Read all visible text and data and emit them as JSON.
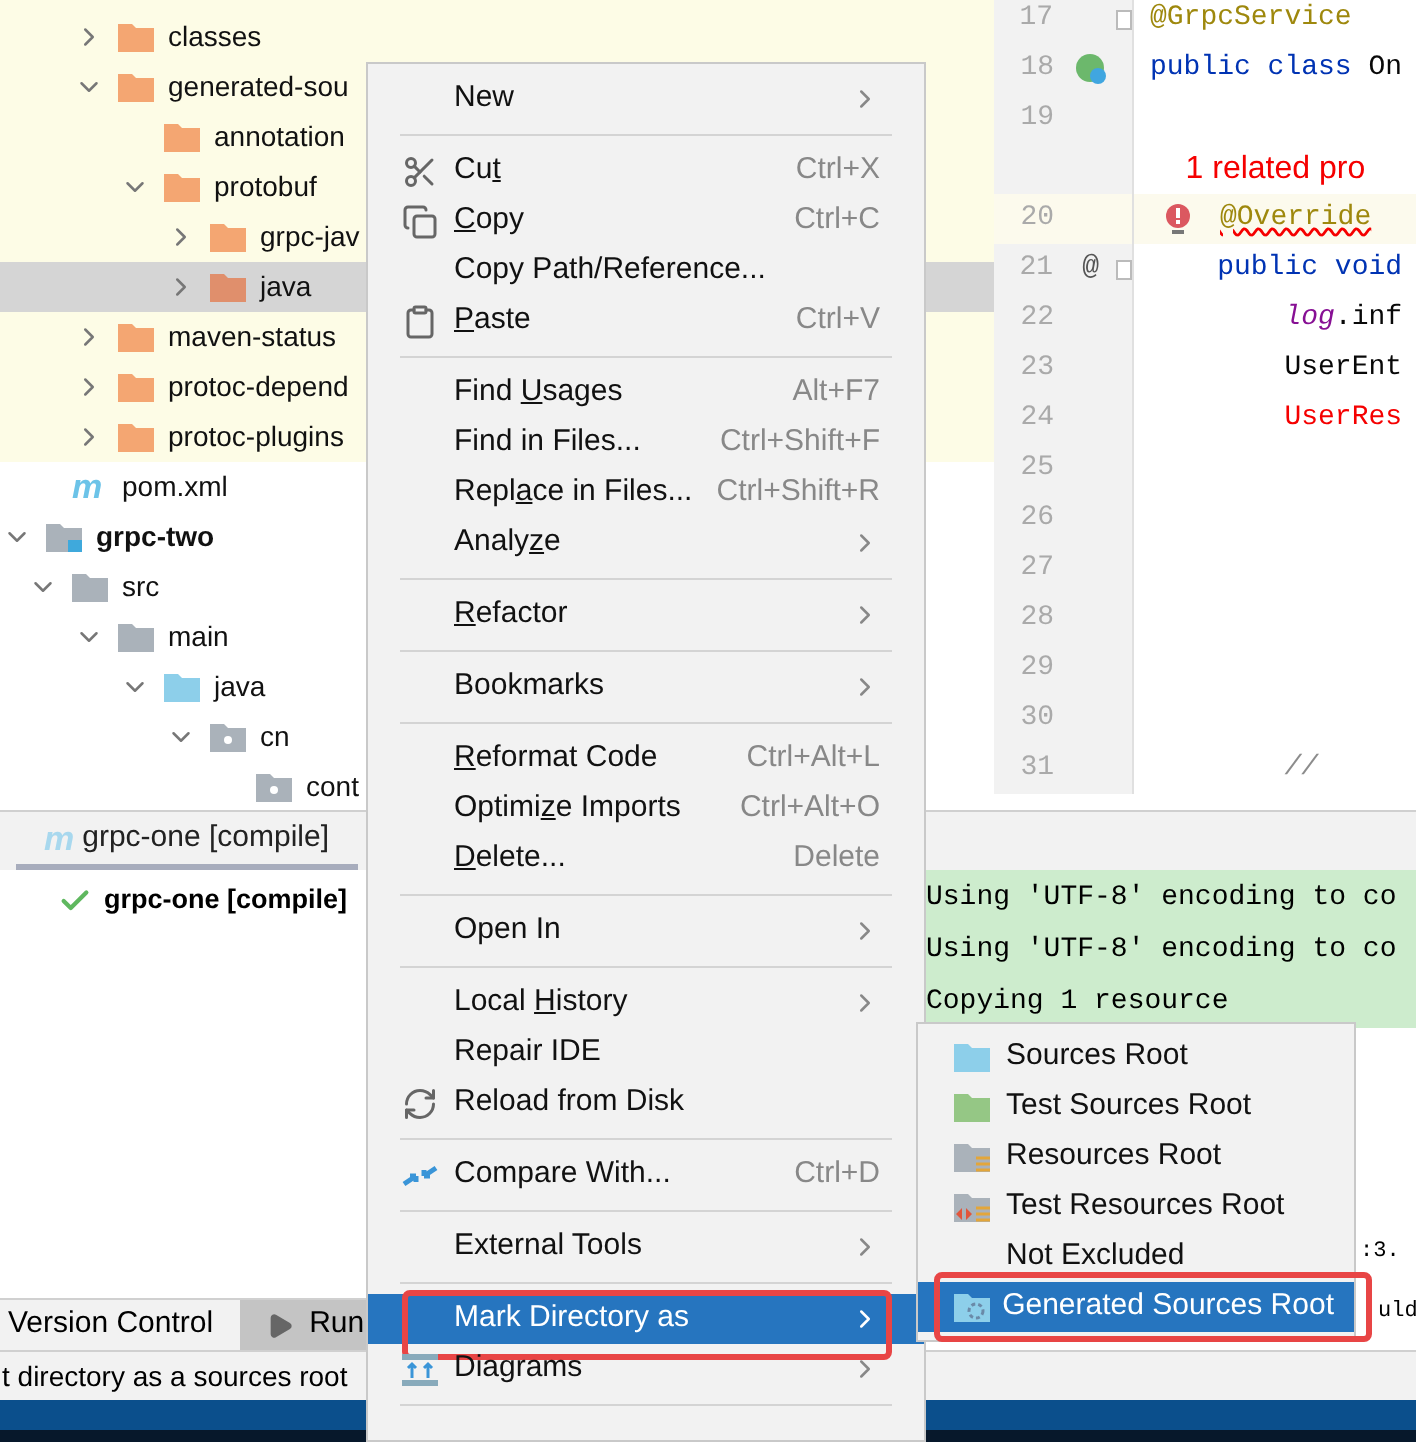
{
  "project_tree": [
    {
      "children": [
        {
          "children": [
            {
              "label": "classes",
              "kind": "excluded-folder",
              "expanded": false,
              "selected": false,
              "excluded": true
            },
            {
              "label": "generated-sou",
              "kind": "excluded-folder",
              "expanded": true,
              "selected": false,
              "excluded": true,
              "children": [
                {
                  "label": "annotation",
                  "kind": "excluded-folder",
                  "selected": false,
                  "excluded": true
                },
                {
                  "label": "protobuf",
                  "kind": "excluded-folder",
                  "expanded": true,
                  "selected": false,
                  "excluded": true,
                  "children": [
                    {
                      "label": "grpc-jav",
                      "kind": "excluded-folder",
                      "expanded": false,
                      "selected": false,
                      "excluded": true
                    },
                    {
                      "label": "java",
                      "kind": "excluded-folder",
                      "expanded": false,
                      "selected": true,
                      "excluded": true
                    }
                  ]
                }
              ]
            },
            {
              "label": "maven-status",
              "kind": "excluded-folder",
              "expanded": false,
              "selected": false,
              "excluded": true
            },
            {
              "label": "protoc-depend",
              "kind": "excluded-folder",
              "expanded": false,
              "selected": false,
              "excluded": true
            },
            {
              "label": "protoc-plugins",
              "kind": "excluded-folder",
              "expanded": false,
              "selected": false,
              "excluded": true
            }
          ]
        },
        {
          "label": "pom.xml",
          "kind": "maven",
          "icon_text": "m",
          "selected": false,
          "excluded": false
        }
      ]
    },
    {
      "label": "grpc-two",
      "kind": "module",
      "expanded": true,
      "selected": false,
      "excluded": false,
      "children": [
        {
          "label": "src",
          "kind": "folder",
          "expanded": true,
          "selected": false,
          "excluded": false,
          "children": [
            {
              "label": "main",
              "kind": "folder",
              "expanded": true,
              "selected": false,
              "excluded": false,
              "children": [
                {
                  "label": "java",
                  "kind": "source-folder",
                  "expanded": true,
                  "selected": false,
                  "excluded": false,
                  "children": [
                    {
                      "label": "cn",
                      "kind": "package",
                      "expanded": true,
                      "selected": false,
                      "excluded": false,
                      "children": [
                        {
                          "label": "cont",
                          "kind": "package",
                          "selected": false,
                          "excluded": false
                        }
                      ]
                    }
                  ]
                }
              ]
            }
          ]
        }
      ]
    }
  ],
  "editor": {
    "lines": [
      {
        "number": "17",
        "kind": "code",
        "fold": true,
        "current": false,
        "tokens": [
          {
            "text": "@GrpcService",
            "kind": "annotation"
          }
        ]
      },
      {
        "number": "18",
        "kind": "bean",
        "current": false,
        "tokens": [
          {
            "text": "public class ",
            "kind": "keyword"
          },
          {
            "text": "On",
            "kind": "plain"
          }
        ]
      },
      {
        "number": "19",
        "kind": "code",
        "current": false
      },
      {
        "kind": "hint",
        "current": false,
        "tokens": [
          {
            "text": "    1 related pro",
            "kind": "error"
          }
        ]
      },
      {
        "number": "20",
        "kind": "error",
        "current": true,
        "tokens": [
          {
            "text": "@Override",
            "kind": "annotation-error"
          }
        ]
      },
      {
        "number": "21",
        "kind": "override",
        "gutter_text": "@",
        "fold": true,
        "current": false,
        "tokens": [
          {
            "text": "    public void",
            "kind": "keyword"
          }
        ]
      },
      {
        "number": "22",
        "kind": "code",
        "current": false,
        "tokens": [
          {
            "text": "        log",
            "kind": "field"
          },
          {
            "text": ".inf",
            "kind": "plain"
          }
        ]
      },
      {
        "number": "23",
        "kind": "code",
        "current": false,
        "tokens": [
          {
            "text": "        UserEnt",
            "kind": "plain"
          }
        ]
      },
      {
        "number": "24",
        "kind": "code",
        "current": false,
        "tokens": [
          {
            "text": "        UserRes",
            "kind": "error"
          }
        ]
      },
      {
        "number": "25",
        "kind": "code",
        "current": false
      },
      {
        "number": "26",
        "kind": "code",
        "current": false
      },
      {
        "number": "27",
        "kind": "code",
        "current": false
      },
      {
        "number": "28",
        "kind": "code",
        "current": false
      },
      {
        "number": "29",
        "kind": "code",
        "current": false
      },
      {
        "number": "30",
        "kind": "code",
        "current": false
      },
      {
        "number": "31",
        "kind": "code",
        "current": false,
        "tokens": [
          {
            "text": "        //",
            "kind": "comment"
          }
        ]
      }
    ]
  },
  "bottom_panel": {
    "tab": {
      "icon_text": "m",
      "label": "grpc-one [compile]",
      "selected": true
    },
    "build_tree": [
      {
        "label": "grpc-one [compile]",
        "kind": "success"
      }
    ],
    "console": [
      {
        "text": "Using 'UTF-8' encoding to co",
        "kind": "info"
      },
      {
        "text": "Using 'UTF-8' encoding to co",
        "kind": "info"
      },
      {
        "text": "Copying 1 resource",
        "kind": "info"
      },
      {
        "text": ":3.",
        "kind": "fragment"
      },
      {
        "text": "uld",
        "kind": "fragment"
      }
    ]
  },
  "tool_strip": [
    {
      "label": "Version Control",
      "kind": "plain",
      "selected": false
    },
    {
      "label": "Run",
      "kind": "run",
      "selected": true
    }
  ],
  "status_bar": {
    "text": "t directory as a sources root"
  },
  "context_menu": [
    {
      "label": "New",
      "submenu": true,
      "selected": false
    },
    {
      "kind": "separator"
    },
    {
      "parts": [
        {
          "text": "Cu",
          "underlined": false
        },
        {
          "text": "t",
          "underlined": true
        }
      ],
      "shortcut": "Ctrl+X",
      "kind": "cut",
      "selected": false
    },
    {
      "parts": [
        {
          "text": "C",
          "underlined": true
        },
        {
          "text": "opy",
          "underlined": false
        }
      ],
      "shortcut": "Ctrl+C",
      "kind": "copy",
      "selected": false
    },
    {
      "label": "Copy Path/Reference...",
      "selected": false
    },
    {
      "parts": [
        {
          "text": "P",
          "underlined": true
        },
        {
          "text": "aste",
          "underlined": false
        }
      ],
      "shortcut": "Ctrl+V",
      "kind": "paste",
      "selected": false
    },
    {
      "kind": "separator"
    },
    {
      "parts": [
        {
          "text": "Find ",
          "underlined": false
        },
        {
          "text": "U",
          "underlined": true
        },
        {
          "text": "sages",
          "underlined": false
        }
      ],
      "shortcut": "Alt+F7",
      "selected": false
    },
    {
      "label": "Find in Files...",
      "shortcut": "Ctrl+Shift+F",
      "selected": false
    },
    {
      "parts": [
        {
          "text": "Repl",
          "underlined": false
        },
        {
          "text": "a",
          "underlined": true
        },
        {
          "text": "ce in Files...",
          "underlined": false
        }
      ],
      "shortcut": "Ctrl+Shift+R",
      "selected": false
    },
    {
      "parts": [
        {
          "text": "Analy",
          "underlined": false
        },
        {
          "text": "z",
          "underlined": true
        },
        {
          "text": "e",
          "underlined": false
        }
      ],
      "submenu": true,
      "selected": false
    },
    {
      "kind": "separator"
    },
    {
      "parts": [
        {
          "text": "R",
          "underlined": true
        },
        {
          "text": "efactor",
          "underlined": false
        }
      ],
      "submenu": true,
      "selected": false
    },
    {
      "kind": "separator"
    },
    {
      "label": "Bookmarks",
      "submenu": true,
      "selected": false
    },
    {
      "kind": "separator"
    },
    {
      "parts": [
        {
          "text": "R",
          "underlined": true
        },
        {
          "text": "eformat Code",
          "underlined": false
        }
      ],
      "shortcut": "Ctrl+Alt+L",
      "selected": false
    },
    {
      "parts": [
        {
          "text": "Optimi",
          "underlined": false
        },
        {
          "text": "z",
          "underlined": true
        },
        {
          "text": "e Imports",
          "underlined": false
        }
      ],
      "shortcut": "Ctrl+Alt+O",
      "selected": false
    },
    {
      "parts": [
        {
          "text": "D",
          "underlined": true
        },
        {
          "text": "elete...",
          "underlined": false
        }
      ],
      "shortcut": "Delete",
      "selected": false
    },
    {
      "kind": "separator"
    },
    {
      "label": "Open In",
      "submenu": true,
      "selected": false
    },
    {
      "kind": "separator"
    },
    {
      "parts": [
        {
          "text": "Local ",
          "underlined": false
        },
        {
          "text": "H",
          "underlined": true
        },
        {
          "text": "istory",
          "underlined": false
        }
      ],
      "submenu": true,
      "selected": false
    },
    {
      "label": "Repair IDE",
      "selected": false
    },
    {
      "label": "Reload from Disk",
      "kind": "reload",
      "selected": false
    },
    {
      "kind": "separator"
    },
    {
      "label": "Compare With...",
      "shortcut": "Ctrl+D",
      "kind": "compare",
      "selected": false
    },
    {
      "kind": "separator"
    },
    {
      "label": "External Tools",
      "submenu": true,
      "selected": false
    },
    {
      "kind": "separator"
    },
    {
      "label": "Mark Directory as",
      "submenu": true,
      "selected": true,
      "annotated": true
    },
    {
      "label": "Diagrams",
      "submenu": true,
      "kind": "diagrams",
      "selected": false
    },
    {
      "kind": "separator"
    }
  ],
  "submenu": [
    {
      "label": "Sources Root",
      "kind": "sources",
      "selected": false,
      "annotated": false
    },
    {
      "label": "Test Sources Root",
      "kind": "test-sources",
      "selected": false,
      "annotated": false
    },
    {
      "label": "Resources Root",
      "kind": "resources",
      "selected": false,
      "annotated": false
    },
    {
      "label": "Test Resources Root",
      "kind": "test-resources",
      "selected": false,
      "annotated": false
    },
    {
      "label": "Not Excluded",
      "kind": "none",
      "selected": false,
      "annotated": false
    },
    {
      "label": "Generated Sources Root",
      "kind": "generated",
      "selected": true,
      "annotated": true
    }
  ]
}
